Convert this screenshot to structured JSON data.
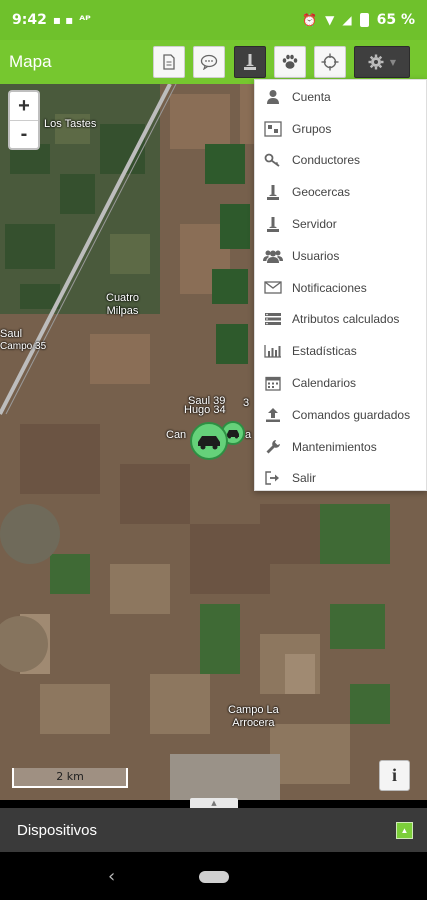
{
  "status_bar": {
    "time": "9:42",
    "battery_percent": "65 %"
  },
  "toolbar": {
    "title": "Mapa",
    "buttons": [
      "report-icon",
      "command-icon",
      "geofence-icon",
      "follow-icon",
      "locate-icon",
      "settings-icon"
    ]
  },
  "map": {
    "zoom_in": "+",
    "zoom_out": "-",
    "labels": {
      "los_tastes": "Los Tastes",
      "cuatro_milpas": "Cuatro\nMilpas",
      "campo_la_arrocera": "Campo La\nArrocera",
      "campo35": "Campo 35",
      "saul": "Saul",
      "vehicle_a": "Saul 39",
      "vehicle_b": "Hugo 34",
      "vehicle_c": "Can",
      "vehicle_c_suffix": "a",
      "vehicle_d_suffix": "3"
    },
    "scale": "2 km",
    "info": "i"
  },
  "menu": {
    "items": [
      {
        "label": "Cuenta",
        "icon": "user-icon"
      },
      {
        "label": "Grupos",
        "icon": "groups-icon"
      },
      {
        "label": "Conductores",
        "icon": "key-icon"
      },
      {
        "label": "Geocercas",
        "icon": "geofence-icon"
      },
      {
        "label": "Servidor",
        "icon": "server-icon"
      },
      {
        "label": "Usuarios",
        "icon": "users-icon"
      },
      {
        "label": "Notificaciones",
        "icon": "envelope-icon"
      },
      {
        "label": "Atributos calculados",
        "icon": "attributes-icon"
      },
      {
        "label": "Estadísticas",
        "icon": "chart-icon"
      },
      {
        "label": "Calendarios",
        "icon": "calendar-icon"
      },
      {
        "label": "Comandos guardados",
        "icon": "upload-icon"
      },
      {
        "label": "Mantenimientos",
        "icon": "wrench-icon"
      },
      {
        "label": "Salir",
        "icon": "logout-icon"
      }
    ]
  },
  "bottom_panel": {
    "title": "Dispositivos"
  },
  "colors": {
    "app_green": "#76c72f",
    "status_green": "#6fc12c",
    "vehicle_green": "#65d17a",
    "panel_dark": "#3a3a3a"
  }
}
